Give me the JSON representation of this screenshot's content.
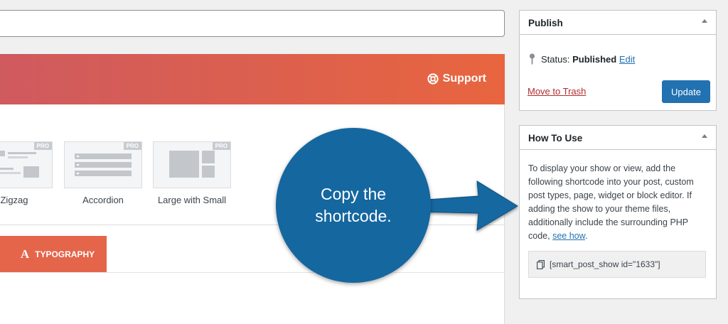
{
  "support": {
    "label": "Support"
  },
  "layouts": [
    {
      "label": "Zigzag",
      "badge": "PRO"
    },
    {
      "label": "Accordion",
      "badge": "PRO"
    },
    {
      "label": "Large with Small",
      "badge": "PRO"
    }
  ],
  "tabs": [
    {
      "label": "TYPOGRAPHY",
      "icon": "A"
    }
  ],
  "publish": {
    "title": "Publish",
    "status_label": "Status:",
    "status_value": "Published",
    "edit_label": "Edit",
    "trash_label": "Move to Trash",
    "update_label": "Update"
  },
  "how_to_use": {
    "title": "How To Use",
    "description": "To display your show or view, add the following shortcode into your post, custom post types, page, widget or block editor. If adding the show to your theme files, additionally include the surrounding PHP code,",
    "see_how_label": "see how",
    "period": ".",
    "shortcode": "[smart_post_show id=\"1633\"]"
  },
  "callout": {
    "line1": "Copy the",
    "line2": "shortcode."
  },
  "colors": {
    "banner_start": "#cf5a5f",
    "banner_end": "#e8653f",
    "tab_active": "#e5654b",
    "primary_button": "#2271b1",
    "trash_link": "#b32d2e",
    "callout": "#1567a0"
  }
}
